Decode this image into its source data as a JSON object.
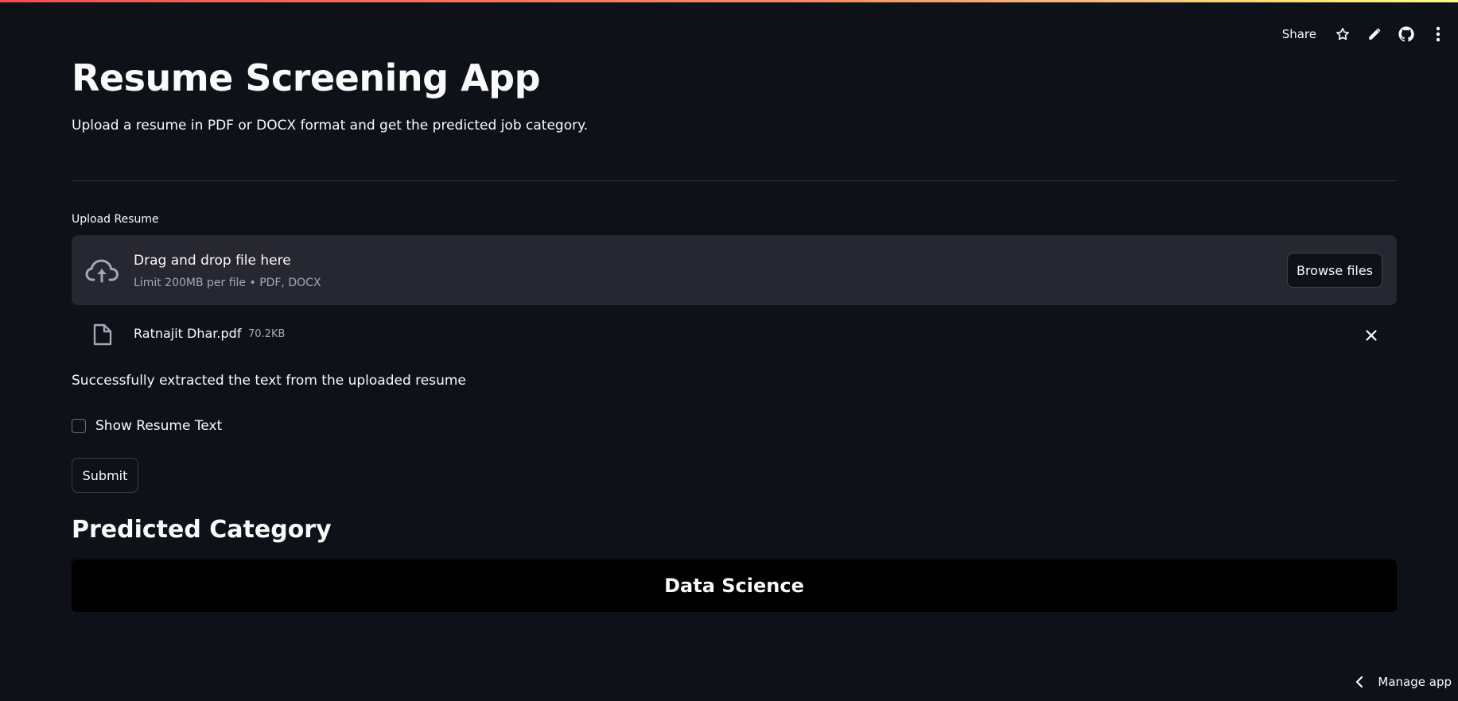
{
  "header": {
    "share_label": "Share",
    "icons": [
      "star-icon",
      "pencil-icon",
      "github-icon",
      "kebab-menu-icon"
    ]
  },
  "app": {
    "title": "Resume Screening App",
    "subtitle": "Upload a resume in PDF or DOCX format and get the predicted job category."
  },
  "uploader": {
    "label": "Upload Resume",
    "drop_title": "Drag and drop file here",
    "limit_text": "Limit 200MB per file • PDF, DOCX",
    "browse_label": "Browse files",
    "file": {
      "name": "Ratnajit Dhar.pdf",
      "size": "70.2KB"
    }
  },
  "status": {
    "success_text": "Successfully extracted the text from the uploaded resume"
  },
  "options": {
    "show_text_label": "Show Resume Text",
    "show_text_checked": false
  },
  "actions": {
    "submit_label": "Submit"
  },
  "prediction": {
    "heading": "Predicted Category",
    "value": "Data Science"
  },
  "footer": {
    "manage_label": "Manage app"
  },
  "colors": {
    "background": "#0e1117",
    "surface": "#262730",
    "accent": "#ff4b4b",
    "result_background": "#000000"
  }
}
